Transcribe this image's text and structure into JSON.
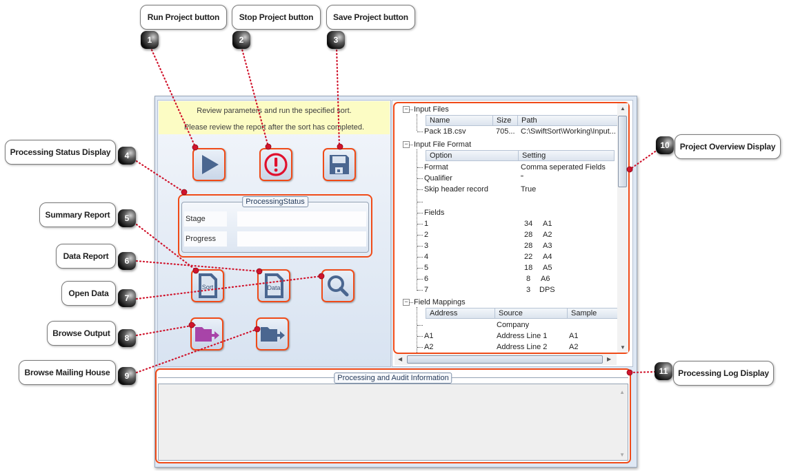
{
  "window": {
    "banner": {
      "line1": "Review parameters and run the specified sort.",
      "line2": "Please review the report after the sort has completed."
    },
    "toolbar": {
      "run_icon": "play-icon",
      "stop_icon": "stop-exclamation-icon",
      "save_icon": "floppy-disk-icon"
    },
    "processing_status": {
      "title": "ProcessingStatus",
      "stage_label": "Stage",
      "stage_value": "",
      "progress_label": "Progress",
      "progress_value": ""
    },
    "report_buttons": {
      "sort_doc_label": "Sort",
      "data_doc_label": "Data"
    },
    "overview": {
      "input_files": {
        "title": "Input Files",
        "columns": [
          "Name",
          "Size",
          "Path"
        ],
        "rows": [
          [
            "Pack 1B.csv",
            "705...",
            "C:\\SwiftSort\\Working\\Input..."
          ]
        ]
      },
      "input_file_format": {
        "title": "Input File Format",
        "columns": [
          "Option",
          "Setting"
        ],
        "rows": [
          [
            "Format",
            "Comma seperated Fields"
          ],
          [
            "Qualifier",
            "\""
          ],
          [
            "Skip header record",
            "True"
          ],
          [
            "",
            ""
          ],
          [
            "Fields",
            ""
          ]
        ],
        "fields": [
          [
            "1",
            "34",
            "A1"
          ],
          [
            "2",
            "28",
            "A2"
          ],
          [
            "3",
            "28",
            "A3"
          ],
          [
            "4",
            "22",
            "A4"
          ],
          [
            "5",
            "18",
            "A5"
          ],
          [
            "6",
            "8",
            "A6"
          ],
          [
            "7",
            "3",
            "DPS"
          ]
        ]
      },
      "field_mappings": {
        "title": "Field Mappings",
        "columns": [
          "Address",
          "Source",
          "Sample"
        ],
        "rows": [
          [
            "",
            "Company",
            ""
          ],
          [
            "A1",
            "Address Line 1",
            "A1"
          ],
          [
            "A2",
            "Address Line 2",
            "A2"
          ]
        ]
      }
    },
    "log": {
      "title": "Processing and Audit Information",
      "content": ""
    }
  },
  "callouts": [
    {
      "num": "1",
      "label": "Run Project button"
    },
    {
      "num": "2",
      "label": "Stop Project button"
    },
    {
      "num": "3",
      "label": "Save Project button"
    },
    {
      "num": "4",
      "label": "Processing Status Display"
    },
    {
      "num": "5",
      "label": "Summary Report"
    },
    {
      "num": "6",
      "label": "Data Report"
    },
    {
      "num": "7",
      "label": "Open Data"
    },
    {
      "num": "8",
      "label": "Browse Output"
    },
    {
      "num": "9",
      "label": "Browse Mailing House"
    },
    {
      "num": "10",
      "label": "Project Overview Display"
    },
    {
      "num": "11",
      "label": "Processing Log Display"
    }
  ],
  "colors": {
    "highlight": "#f04a17",
    "callout_line": "#d0142c",
    "icon_blue": "#4a6690",
    "stop_red": "#e0102e",
    "browse_output_magenta": "#a844a8",
    "banner_yellow": "#fcfcc4"
  }
}
